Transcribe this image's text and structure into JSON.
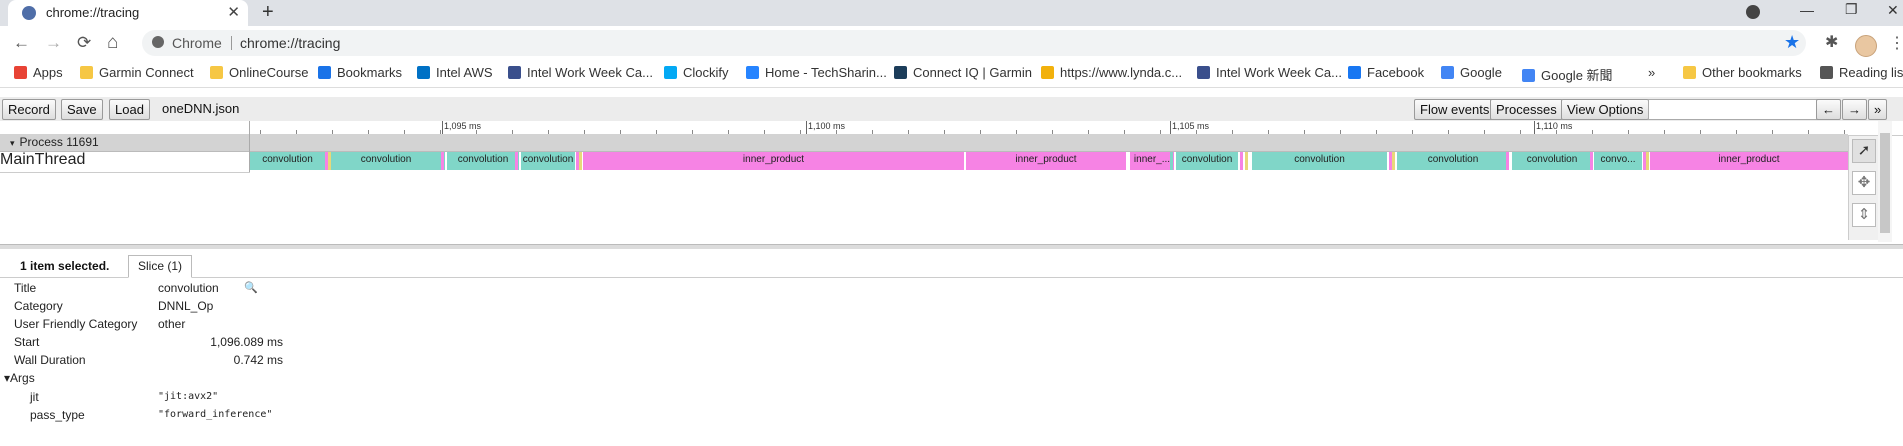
{
  "tab": {
    "title": "chrome://tracing",
    "close": "✕"
  },
  "newtab": "+",
  "window": {
    "minimize": "—",
    "restore": "❐",
    "close": "✕"
  },
  "nav": {
    "back": "←",
    "forward": "→",
    "reload": "⟳",
    "home": "⌂"
  },
  "omnibox": {
    "chip": "Chrome",
    "url": "chrome://tracing"
  },
  "icons": {
    "star": "★",
    "extensions": "✱",
    "menu": "⋮",
    "cursor": "➚",
    "pan": "✥",
    "zoom": "⇕",
    "search": "🔍"
  },
  "bookmarks": [
    {
      "label": "Apps",
      "icon": "apps-grid-icon",
      "color": "#e84335"
    },
    {
      "label": "Garmin Connect",
      "icon": "folder-icon",
      "color": "#f6c744"
    },
    {
      "label": "OnlineCourse",
      "icon": "folder-icon",
      "color": "#f6c744"
    },
    {
      "label": "Bookmarks",
      "icon": "star-icon",
      "color": "#1a73e8"
    },
    {
      "label": "Intel AWS",
      "icon": "intel-icon",
      "color": "#0071c5"
    },
    {
      "label": "Intel Work Week Ca...",
      "icon": "globe-icon",
      "color": "#3a4f8c"
    },
    {
      "label": "Clockify",
      "icon": "clockify-icon",
      "color": "#03a9f4"
    },
    {
      "label": "Home - TechSharin...",
      "icon": "confluence-icon",
      "color": "#2684ff"
    },
    {
      "label": "Connect IQ | Garmin",
      "icon": "triangle-icon",
      "color": "#1c3d5a"
    },
    {
      "label": "https://www.lynda.c...",
      "icon": "lynda-icon",
      "color": "#f2b10c"
    },
    {
      "label": "Intel Work Week Ca...",
      "icon": "globe-icon",
      "color": "#3a4f8c"
    },
    {
      "label": "Facebook",
      "icon": "facebook-icon",
      "color": "#1877f2"
    },
    {
      "label": "Google",
      "icon": "google-icon",
      "color": "#4285f4"
    },
    {
      "label": "Google 新聞",
      "icon": "google-news-icon",
      "color": "#4285f4"
    },
    {
      "label": "»",
      "icon": "overflow-icon",
      "color": "#555"
    },
    {
      "label": "Other bookmarks",
      "icon": "folder-icon",
      "color": "#f6c744"
    },
    {
      "label": "Reading list",
      "icon": "reading-list-icon",
      "color": "#555"
    }
  ],
  "trace_toolbar": {
    "record": "Record",
    "save": "Save",
    "load": "Load",
    "filename": "oneDNN.json",
    "flow_events": "Flow events",
    "processes": "Processes",
    "view_options": "View Options",
    "nav_left": "←",
    "nav_right": "→",
    "help": "»"
  },
  "ruler": {
    "ticks": [
      "1,095 ms",
      "1,100 ms",
      "1,105 ms",
      "1,110 ms"
    ]
  },
  "process": {
    "label": "Process 11691",
    "toggle": "▾"
  },
  "thread": {
    "label": "MainThread",
    "slices": [
      {
        "name": "convolution",
        "color": "#80d6c8"
      },
      {
        "name": "convolution",
        "color": "#80d6c8"
      },
      {
        "name": "convolution",
        "color": "#80d6c8"
      },
      {
        "name": "convolution",
        "color": "#80d6c8"
      },
      {
        "name": "inner_product",
        "color": "#f683e4"
      },
      {
        "name": "inner_product",
        "color": "#f683e4"
      },
      {
        "name": "inner_...",
        "color": "#f683e4"
      },
      {
        "name": "convolution",
        "color": "#80d6c8"
      },
      {
        "name": "convolution",
        "color": "#80d6c8"
      },
      {
        "name": "convolution",
        "color": "#80d6c8"
      },
      {
        "name": "convolution",
        "color": "#80d6c8"
      },
      {
        "name": "convo...",
        "color": "#80d6c8"
      },
      {
        "name": "inner_product",
        "color": "#f683e4"
      }
    ]
  },
  "analysis": {
    "selected": "1 item selected.",
    "tab": "Slice (1)"
  },
  "details": {
    "title_label": "Title",
    "title_value": "convolution",
    "category_label": "Category",
    "category_value": "DNNL_Op",
    "ufc_label": "User Friendly Category",
    "ufc_value": "other",
    "start_label": "Start",
    "start_value": "1,096.089 ms",
    "wall_label": "Wall Duration",
    "wall_value": "0.742 ms",
    "args_label": "▾Args",
    "jit_label": "jit",
    "jit_value": "\"jit:avx2\"",
    "pass_label": "pass_type",
    "pass_value": "\"forward_inference\""
  }
}
